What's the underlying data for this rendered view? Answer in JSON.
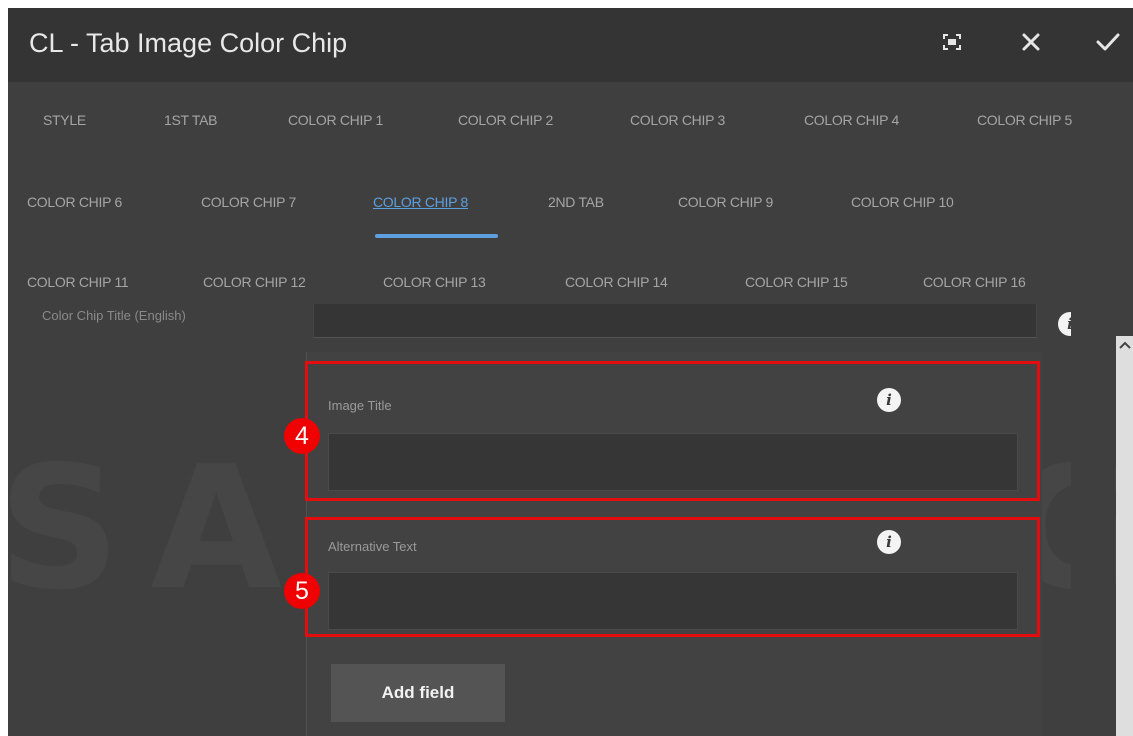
{
  "dialog": {
    "title": "CL - Tab Image Color Chip"
  },
  "toolbar": {
    "fullscreen_icon": "fullscreen-icon",
    "close_icon": "close-icon",
    "confirm_icon": "checkmark-icon"
  },
  "tabs": {
    "row1": [
      "STYLE",
      "1ST TAB",
      "COLOR CHIP 1",
      "COLOR CHIP 2",
      "COLOR CHIP 3",
      "COLOR CHIP 4",
      "COLOR CHIP 5"
    ],
    "row2": [
      "COLOR CHIP 6",
      "COLOR CHIP 7",
      "COLOR CHIP 8",
      "2ND TAB",
      "COLOR CHIP 9",
      "COLOR CHIP 10"
    ],
    "row3": [
      "COLOR CHIP 11",
      "COLOR CHIP 12",
      "COLOR CHIP 13",
      "COLOR CHIP 14",
      "COLOR CHIP 15",
      "COLOR CHIP 16"
    ],
    "active": "COLOR CHIP 8"
  },
  "form": {
    "partial_label": "Color Chip Title (English)",
    "image_title_label": "Image Title",
    "image_title_value": "",
    "alt_text_label": "Alternative Text",
    "alt_text_value": "",
    "add_field_label": "Add field",
    "info_glyph": "i"
  },
  "annotations": {
    "marker_4": "4",
    "marker_5": "5",
    "highlight_color": "#e40d0d"
  },
  "watermark": "SAMSUNG",
  "colors": {
    "accent": "#5e9fe0",
    "dialog_bg": "#3f3f3f",
    "titlebar_bg": "#343434"
  }
}
